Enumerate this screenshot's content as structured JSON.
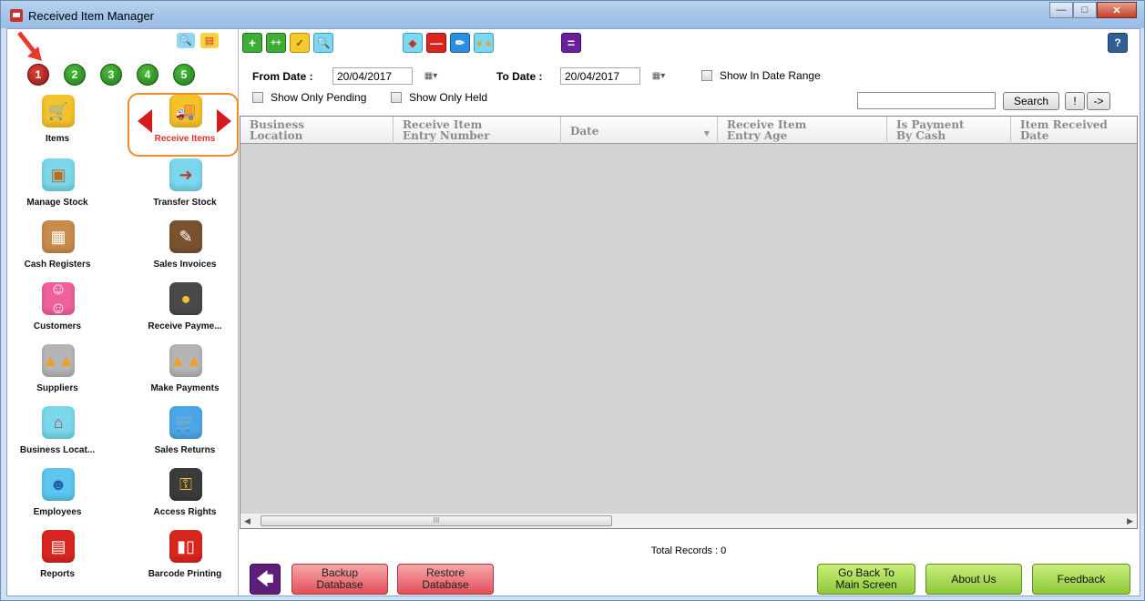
{
  "window": {
    "title": "Received Item Manager",
    "controls": [
      "minimize",
      "maximize",
      "close"
    ]
  },
  "sidebar": {
    "pages": [
      "1",
      "2",
      "3",
      "4",
      "5"
    ],
    "active_page": "1",
    "items": [
      {
        "label": "Items",
        "icon": "shopping-cart-icon",
        "color": "#f4c22b"
      },
      {
        "label": "Receive Items",
        "icon": "truck-icon",
        "color": "#f4c22b",
        "active": true
      },
      {
        "label": "Manage Stock",
        "icon": "hand-truck-icon",
        "color": "#7ad7ee"
      },
      {
        "label": "Transfer Stock",
        "icon": "transfer-stock-icon",
        "color": "#7ad7ee"
      },
      {
        "label": "Cash Registers",
        "icon": "cash-register-icon",
        "color": "#c98a4a"
      },
      {
        "label": "Sales Invoices",
        "icon": "invoice-icon",
        "color": "#7a5230"
      },
      {
        "label": "Customers",
        "icon": "customers-icon",
        "color": "#f0609a"
      },
      {
        "label": "Receive Payme...",
        "icon": "coins-icon",
        "color": "#4a4a4a"
      },
      {
        "label": "Suppliers",
        "icon": "factory-icon",
        "color": "#b5b5b5"
      },
      {
        "label": "Make Payments",
        "icon": "factory-payment-icon",
        "color": "#b5b5b5"
      },
      {
        "label": "Business Locat...",
        "icon": "shop-icon",
        "color": "#7ad7ee"
      },
      {
        "label": "Sales Returns",
        "icon": "return-cart-icon",
        "color": "#4aa6e8"
      },
      {
        "label": "Employees",
        "icon": "employee-icon",
        "color": "#5cc6ee"
      },
      {
        "label": "Access Rights",
        "icon": "lock-key-icon",
        "color": "#3b3b3b"
      },
      {
        "label": "Reports",
        "icon": "report-icon",
        "color": "#d8261f"
      },
      {
        "label": "Barcode Printing",
        "icon": "barcode-icon",
        "color": "#d8261f"
      }
    ]
  },
  "filters": {
    "from_label": "From Date :",
    "from_value": "20/04/2017",
    "to_label": "To Date :",
    "to_value": "20/04/2017",
    "show_in_range": "Show In Date Range",
    "show_pending": "Show Only Pending",
    "show_held": "Show Only Held",
    "search_value": "",
    "search_button": "Search",
    "bang_button": "!",
    "arrow_button": "->"
  },
  "grid": {
    "columns": [
      "Business\nLocation",
      "Receive Item\nEntry Number",
      "Date",
      "Receive Item\nEntry Age",
      "Is Payment\nBy Cash",
      "Item Received\nDate"
    ],
    "rows": [],
    "scroll_thumb": "III"
  },
  "footer": {
    "total_records": "Total Records : 0",
    "backup": "Backup\nDatabase",
    "restore": "Restore\nDatabase",
    "go_back": "Go Back To\nMain Screen",
    "about": "About Us",
    "feedback": "Feedback"
  },
  "help_label": "?"
}
